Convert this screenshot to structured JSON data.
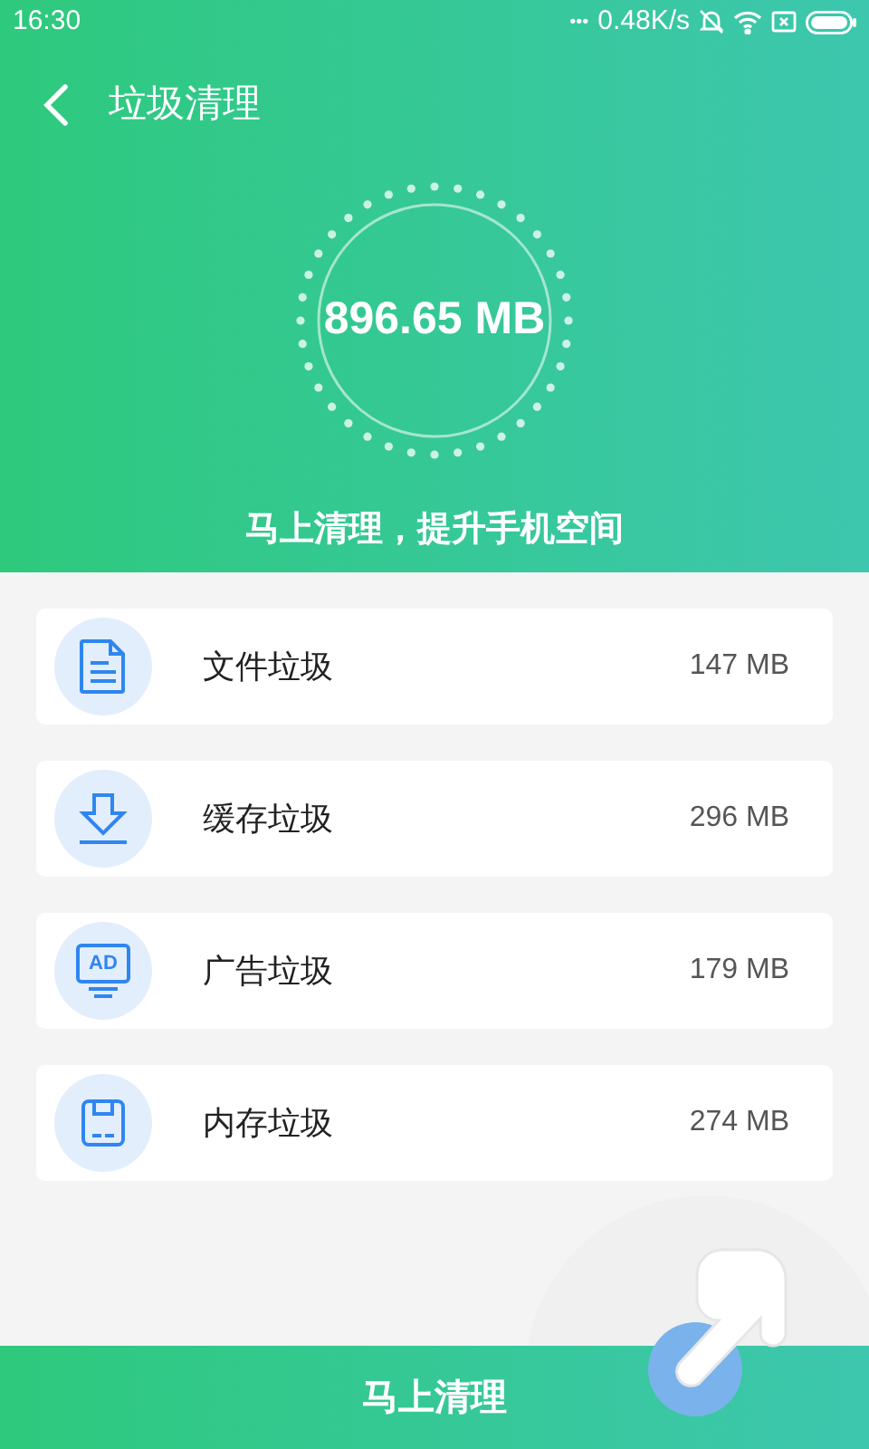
{
  "status_bar": {
    "time": "16:30",
    "dots": "•••",
    "speed": "0.48K/s"
  },
  "header": {
    "title": "垃圾清理"
  },
  "summary": {
    "size": "896.65 MB",
    "subtitle": "马上清理，提升手机空间"
  },
  "items": [
    {
      "kind": "file",
      "name": "文件垃圾",
      "size": "147 MB"
    },
    {
      "kind": "download",
      "name": "缓存垃圾",
      "size": "296 MB"
    },
    {
      "kind": "ad",
      "icon_text": "AD",
      "name": "广告垃圾",
      "size": "179 MB"
    },
    {
      "kind": "storage",
      "name": "内存垃圾",
      "size": "274 MB"
    }
  ],
  "clean_button": {
    "label": "马上清理"
  }
}
